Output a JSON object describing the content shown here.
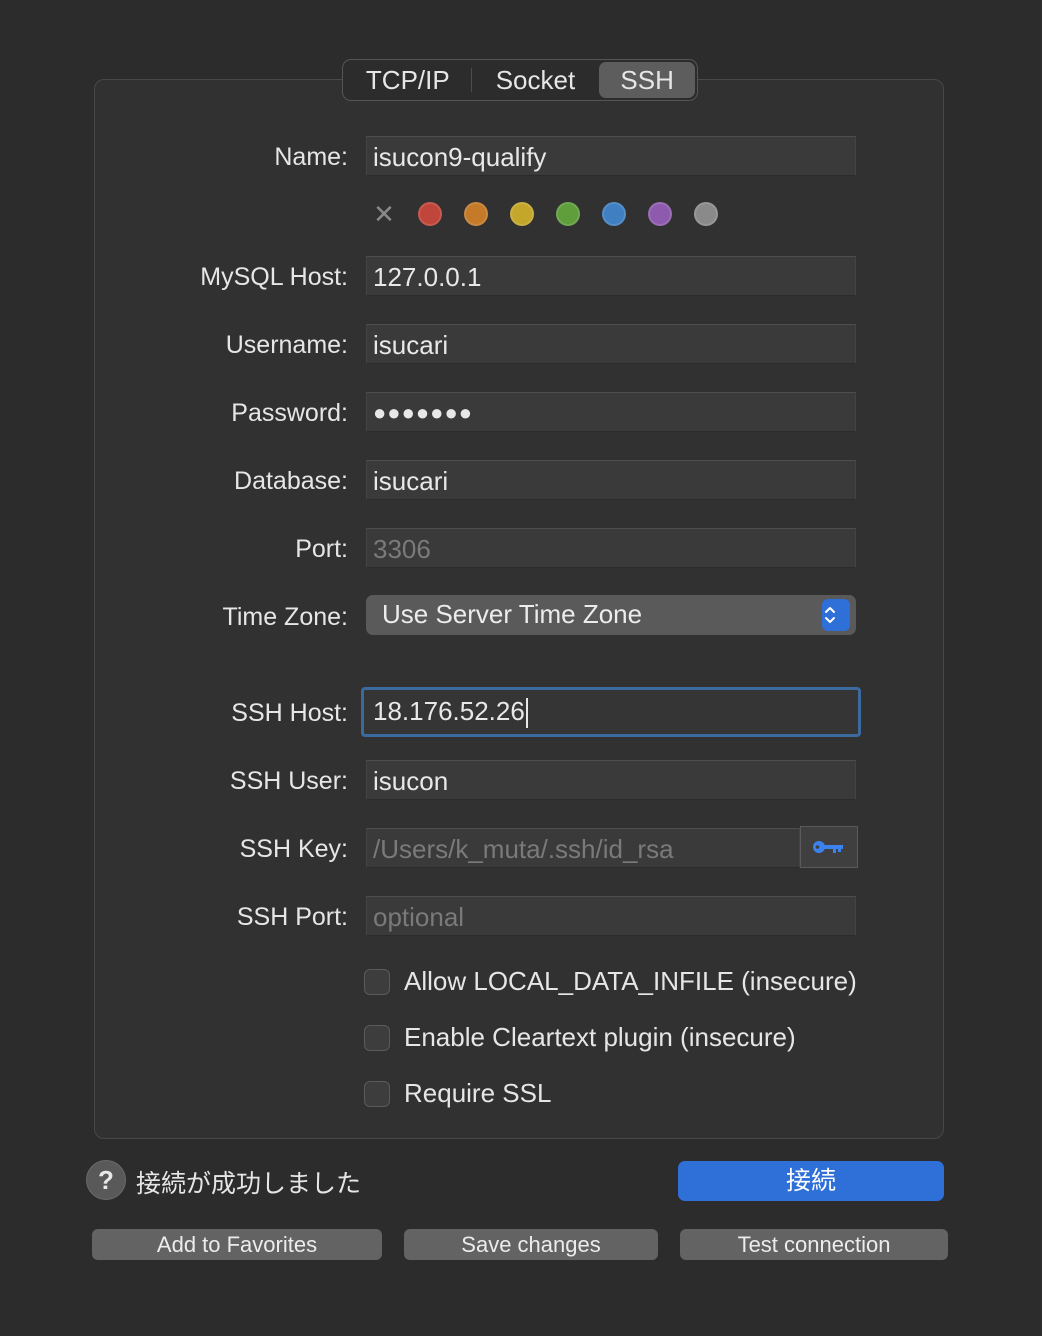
{
  "tabs": [
    {
      "label": "TCP/IP"
    },
    {
      "label": "Socket"
    },
    {
      "label": "SSH",
      "selected": true
    }
  ],
  "form": {
    "name": {
      "label": "Name:",
      "value": "isucon9-qualify"
    },
    "mysql_host": {
      "label": "MySQL Host:",
      "value": "127.0.0.1"
    },
    "username": {
      "label": "Username:",
      "value": "isucari"
    },
    "password": {
      "label": "Password:",
      "value": "●●●●●●●"
    },
    "database": {
      "label": "Database:",
      "value": "isucari"
    },
    "port": {
      "label": "Port:",
      "placeholder": "3306"
    },
    "time_zone": {
      "label": "Time Zone:",
      "value": "Use Server Time Zone"
    },
    "ssh_host": {
      "label": "SSH Host:",
      "value": "18.176.52.26"
    },
    "ssh_user": {
      "label": "SSH User:",
      "value": "isucon"
    },
    "ssh_key": {
      "label": "SSH Key:",
      "placeholder": "/Users/k_muta/.ssh/id_rsa"
    },
    "ssh_port": {
      "label": "SSH Port:",
      "placeholder": "optional"
    }
  },
  "color_tags": [
    "#c0453a",
    "#c47a28",
    "#c4a72a",
    "#5f9e3b",
    "#3f7fc2",
    "#8e5aae",
    "#8a8a8a"
  ],
  "options": [
    {
      "label": "Allow LOCAL_DATA_INFILE (insecure)",
      "checked": false
    },
    {
      "label": "Enable Cleartext plugin (insecure)",
      "checked": false
    },
    {
      "label": "Require SSL",
      "checked": false
    }
  ],
  "status": {
    "help": "?",
    "message": "接続が成功しました"
  },
  "buttons": {
    "connect": "接続",
    "add_favorites": "Add to Favorites",
    "save_changes": "Save changes",
    "test_connection": "Test connection"
  },
  "accent_color": "#2f6fd8",
  "icons": {
    "key_button": "key-icon",
    "select_arrows": "chevron-up-down-icon"
  }
}
